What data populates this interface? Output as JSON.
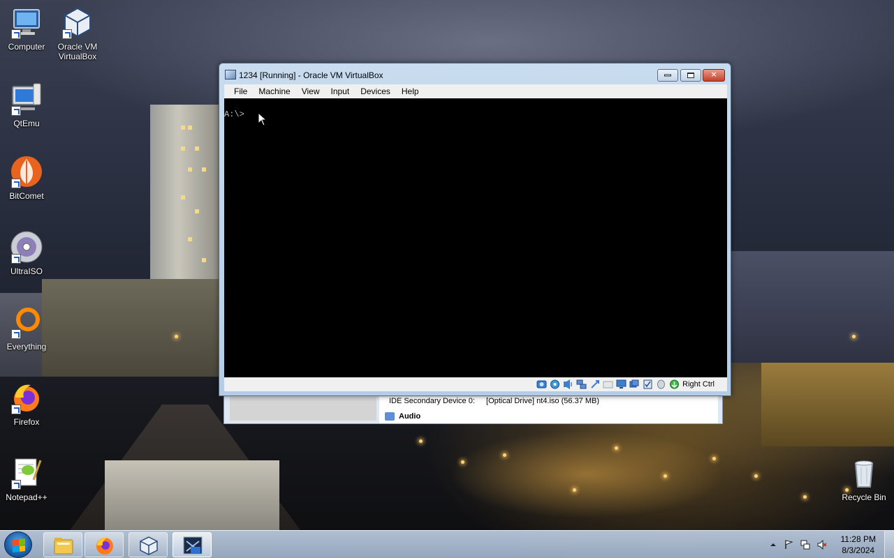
{
  "desktop": {
    "icons": [
      {
        "label": "Computer",
        "icon": "computer-icon"
      },
      {
        "label": "Oracle VM VirtualBox",
        "icon": "virtualbox-icon"
      },
      {
        "label": "QtEmu",
        "icon": "qtemu-icon"
      },
      {
        "label": "BitComet",
        "icon": "bitcomet-icon"
      },
      {
        "label": "UltraISO",
        "icon": "ultraiso-icon"
      },
      {
        "label": "Everything",
        "icon": "everything-icon"
      },
      {
        "label": "Firefox",
        "icon": "firefox-icon"
      },
      {
        "label": "Notepad++",
        "icon": "notepad-plus-plus-icon"
      },
      {
        "label": "Recycle Bin",
        "icon": "recycle-bin-icon"
      }
    ]
  },
  "background_window": {
    "device_label": "IDE Secondary Device 0:",
    "device_value": "[Optical Drive] nt4.iso (56.37 MB)",
    "audio_label": "Audio"
  },
  "vm_window": {
    "title": "1234 [Running] - Oracle VM VirtualBox",
    "menu": [
      "File",
      "Machine",
      "View",
      "Input",
      "Devices",
      "Help"
    ],
    "console_text": "A:\\>",
    "host_key": "Right Ctrl",
    "status_icons": [
      "hard-disk-icon",
      "optical-drive-icon",
      "audio-icon",
      "network-icon",
      "usb-icon",
      "shared-folders-icon",
      "display-icon",
      "video-capture-icon",
      "cpu-icon",
      "mouse-integration-icon",
      "keyboard-capture-icon"
    ]
  },
  "taskbar": {
    "pinned": [
      "explorer-icon",
      "firefox-icon",
      "virtualbox-icon",
      "nt-vm-icon"
    ],
    "clock_time": "11:28 PM",
    "clock_date": "8/3/2024"
  },
  "colors": {
    "vm_frame": "#b4cce6",
    "close_button": "#c3412a",
    "console_bg": "#000000",
    "console_text": "#bfbfbf"
  }
}
